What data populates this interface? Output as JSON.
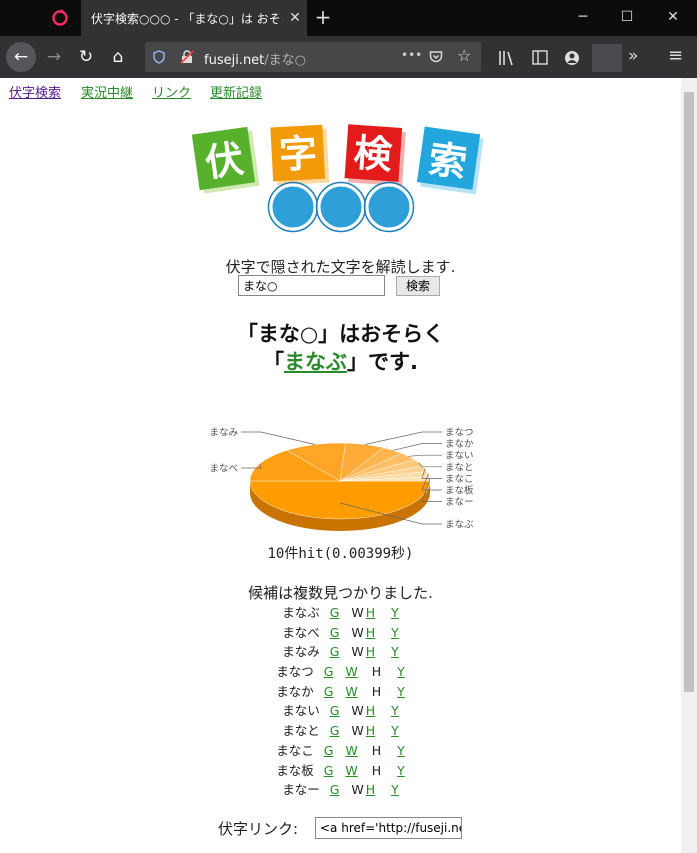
{
  "browser": {
    "tab_title": "伏字検索○○○ - 「まな○」は おそら",
    "url_host": "fuseji.net",
    "url_path": "/まな○",
    "new_tab": "+",
    "close_tab": "✕",
    "more": "•••",
    "overflow": "»",
    "menu": "≡"
  },
  "nav": {
    "links": [
      "伏字検索",
      "実況中継",
      "リンク",
      "更新記録"
    ]
  },
  "logo": {
    "chars": [
      "伏",
      "字",
      "検",
      "索"
    ]
  },
  "search": {
    "intro": "伏字で隠された文字を解読します.",
    "value": "まな○",
    "button": "検索"
  },
  "result": {
    "line1": "「まな○」はおそらく",
    "open": "「",
    "answer": "まなぶ",
    "close": "」です."
  },
  "chart_data": {
    "type": "pie",
    "labels": [
      "まなぶ",
      "まなべ",
      "まなみ",
      "まなつ",
      "まなか",
      "まない",
      "まなと",
      "まなこ",
      "まな板",
      "まなー"
    ],
    "values": [
      0.5,
      0.15,
      0.11,
      0.07,
      0.04,
      0.035,
      0.03,
      0.025,
      0.022,
      0.018
    ],
    "colors": [
      "#ff9c00",
      "#ffa015",
      "#ffa628",
      "#ffab3a",
      "#ffb550",
      "#ffbf66",
      "#ffc97c",
      "#ffd292",
      "#ffdba6",
      "#ffe3b8"
    ]
  },
  "stats": {
    "hits": "10件hit(0.00399秒)"
  },
  "candidates": {
    "heading": "候補は複数見つかりました.",
    "rows": [
      {
        "word": "まなぶ",
        "g": "G",
        "w": "W",
        "w_link": false,
        "h": "H",
        "h_link": true,
        "y": "Y"
      },
      {
        "word": "まなべ",
        "g": "G",
        "w": "W",
        "w_link": false,
        "h": "H",
        "h_link": true,
        "y": "Y"
      },
      {
        "word": "まなみ",
        "g": "G",
        "w": "W",
        "w_link": false,
        "h": "H",
        "h_link": true,
        "y": "Y"
      },
      {
        "word": "まなつ",
        "g": "G",
        "w": "W",
        "w_link": true,
        "h": "H",
        "h_link": false,
        "y": "Y"
      },
      {
        "word": "まなか",
        "g": "G",
        "w": "W",
        "w_link": true,
        "h": "H",
        "h_link": false,
        "y": "Y"
      },
      {
        "word": "まない",
        "g": "G",
        "w": "W",
        "w_link": false,
        "h": "H",
        "h_link": true,
        "y": "Y"
      },
      {
        "word": "まなと",
        "g": "G",
        "w": "W",
        "w_link": false,
        "h": "H",
        "h_link": true,
        "y": "Y"
      },
      {
        "word": "まなこ",
        "g": "G",
        "w": "W",
        "w_link": true,
        "h": "H",
        "h_link": false,
        "y": "Y"
      },
      {
        "word": "まな板",
        "g": "G",
        "w": "W",
        "w_link": true,
        "h": "H",
        "h_link": false,
        "y": "Y"
      },
      {
        "word": "まなー",
        "g": "G",
        "w": "W",
        "w_link": false,
        "h": "H",
        "h_link": true,
        "y": "Y"
      }
    ]
  },
  "fuseji_link": {
    "label": "伏字リンク:",
    "value": "<a href='http://fuseji.ne"
  }
}
